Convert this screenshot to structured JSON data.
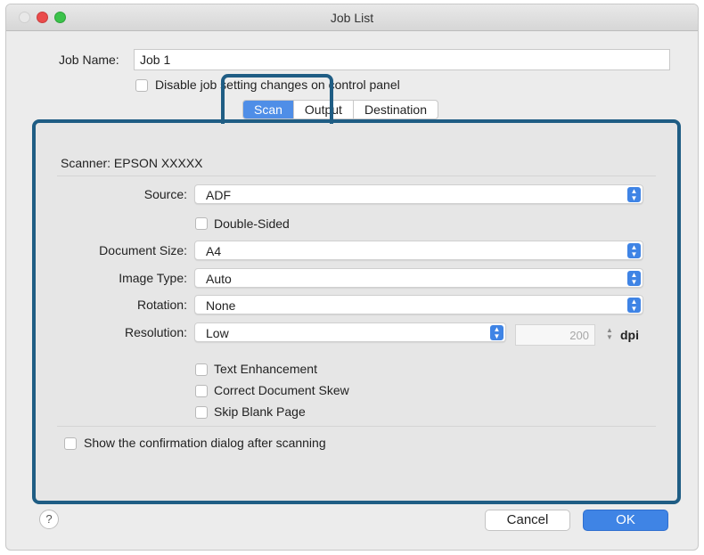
{
  "window": {
    "title": "Job List"
  },
  "job": {
    "name_label": "Job Name:",
    "name_value": "Job 1",
    "disable_label": "Disable job setting changes on control panel"
  },
  "tabs": [
    {
      "label": "Scan",
      "active": true
    },
    {
      "label": "Output",
      "active": false
    },
    {
      "label": "Destination",
      "active": false
    }
  ],
  "scan": {
    "scanner_label": "Scanner: EPSON XXXXX",
    "source_label": "Source:",
    "source_value": "ADF",
    "double_sided_label": "Double-Sided",
    "doc_size_label": "Document Size:",
    "doc_size_value": "A4",
    "image_type_label": "Image Type:",
    "image_type_value": "Auto",
    "rotation_label": "Rotation:",
    "rotation_value": "None",
    "resolution_label": "Resolution:",
    "resolution_value": "Low",
    "dpi_value": "200",
    "dpi_unit": "dpi",
    "text_enhancement_label": "Text Enhancement",
    "correct_skew_label": "Correct Document Skew",
    "skip_blank_label": "Skip Blank Page",
    "show_confirmation_label": "Show the confirmation dialog after scanning"
  },
  "footer": {
    "help_label": "?",
    "cancel_label": "Cancel",
    "ok_label": "OK"
  },
  "colors": {
    "accent": "#3f84e5",
    "highlight_frame": "#1f5d84"
  }
}
